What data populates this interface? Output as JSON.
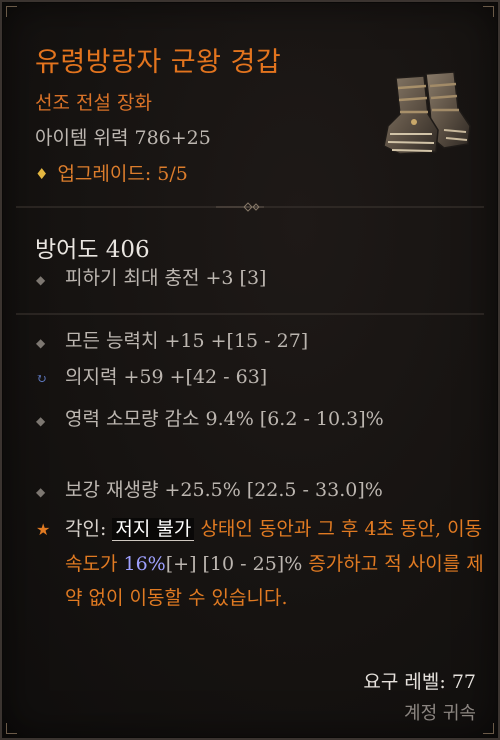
{
  "item": {
    "name": "유령방랑자 군왕 경갑",
    "type": "선조 전설 장화",
    "item_power": "아이템 위력 786+25",
    "upgrade_gem_icon": "diamond-gem-icon",
    "upgrade": "업그레이드: 5/5"
  },
  "defense": {
    "armor": "방어도 406",
    "implicit": "피하기 최대 충전 +3 [3]"
  },
  "affixes": [
    {
      "icon": "diamond-bullet-icon",
      "text": "모든 능력치 +15 +[15 - 27]"
    },
    {
      "icon": "refresh-bullet-icon",
      "text": "의지력 +59 +[42 - 63]"
    },
    {
      "icon": "diamond-bullet-icon",
      "text": "영력 소모량 감소 9.4% [6.2 - 10.3]%"
    },
    {
      "icon": "diamond-bullet-icon",
      "text": "보강 재생량 +25.5% [22.5 - 33.0]%"
    }
  ],
  "aspect": {
    "icon": "star-bullet-icon",
    "label": "각인:",
    "keyword": "저지 불가",
    "text_1": "상태인 동안과 그 후 4초 동안, 이동 속도가",
    "value": "16%",
    "range": "[+] [10 - 25]%",
    "text_2": "증가하고 적 사이를 제약 없이 이동할 수 있습니다."
  },
  "footer": {
    "required_level": "요구 레벨: 77",
    "binding": "계정 귀속"
  },
  "colors": {
    "legendary_orange": "#e3741e",
    "highlight_blue": "#9ea0ff",
    "affix_gray": "#bcb6b0"
  }
}
